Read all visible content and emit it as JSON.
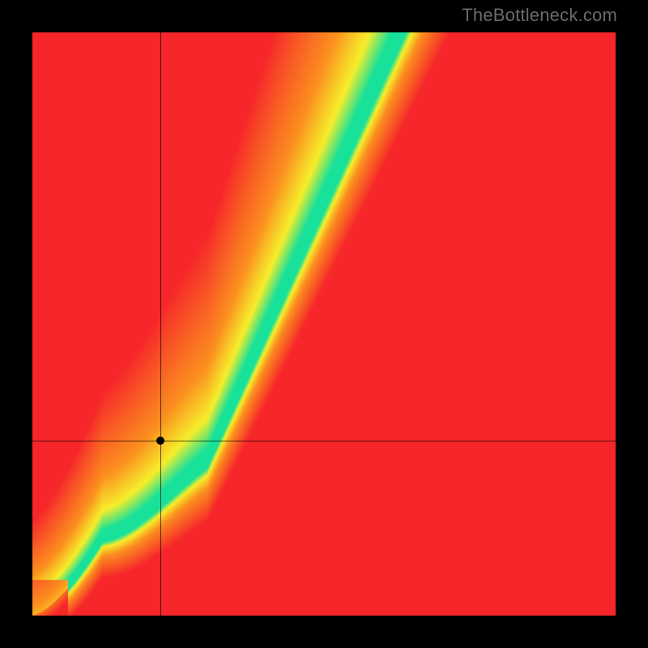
{
  "attribution": "TheBottleneck.com",
  "chart_data": {
    "type": "heatmap",
    "title": "",
    "xlabel": "",
    "ylabel": "",
    "xlim": [
      0,
      100
    ],
    "ylim": [
      0,
      100
    ],
    "colorscale": "red-yellow-green (green = optimal, red = bottleneck)",
    "optimal_curve_description": "Near-linear steep diagonal where optimal y ≈ 2.2*x - 40 for mid/high x; bends toward origin at low x",
    "marker": {
      "x": 22,
      "y": 30,
      "note": "selected hardware pairing"
    },
    "crosshair": {
      "x": 22,
      "y": 30
    },
    "grid": false,
    "legend": false
  },
  "colors": {
    "green": "#18e19a",
    "yellow": "#f6ee2b",
    "orange": "#fb8f1f",
    "red": "#f6262a",
    "background": "#000000"
  }
}
